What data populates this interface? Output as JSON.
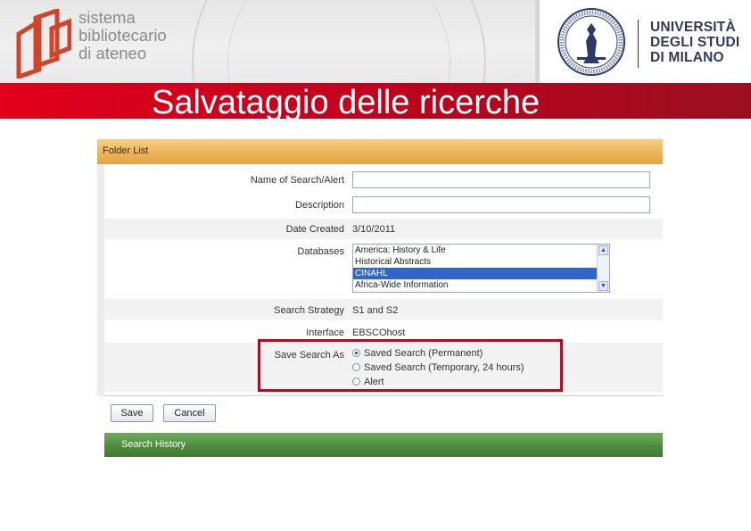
{
  "header": {
    "left_logo_lines": [
      "sistema",
      "bibliotecario",
      "di ateneo"
    ],
    "university_lines": [
      "UNIVERSITÀ",
      "DEGLI STUDI",
      "DI MILANO"
    ],
    "slide_title": "Salvataggio delle ricerche"
  },
  "dialog": {
    "section_title": "Folder List",
    "fields": {
      "name_label": "Name of Search/Alert",
      "name_value": "",
      "description_label": "Description",
      "description_value": "",
      "date_label": "Date Created",
      "date_value": "3/10/2011",
      "databases_label": "Databases",
      "databases_options": [
        "America: History & Life",
        "Historical Abstracts",
        "CINAHL",
        "Africa-Wide Information"
      ],
      "databases_selected": "CINAHL",
      "strategy_label": "Search Strategy",
      "strategy_value": "S1 and S2",
      "interface_label": "Interface",
      "interface_value": "EBSCOhost",
      "save_as_label": "Save Search As",
      "save_as_options": [
        "Saved Search (Permanent)",
        "Saved Search (Temporary, 24 hours)",
        "Alert"
      ],
      "save_as_selected": "Saved Search (Permanent)"
    },
    "buttons": {
      "save": "Save",
      "cancel": "Cancel"
    },
    "history_title": "Search History"
  },
  "colors": {
    "title_bar": "#c4001d",
    "highlight_border": "#c8001b",
    "folder_bar": "#ecb55a",
    "history_bar": "#4f8d3e",
    "selected_option": "#3166c9"
  }
}
